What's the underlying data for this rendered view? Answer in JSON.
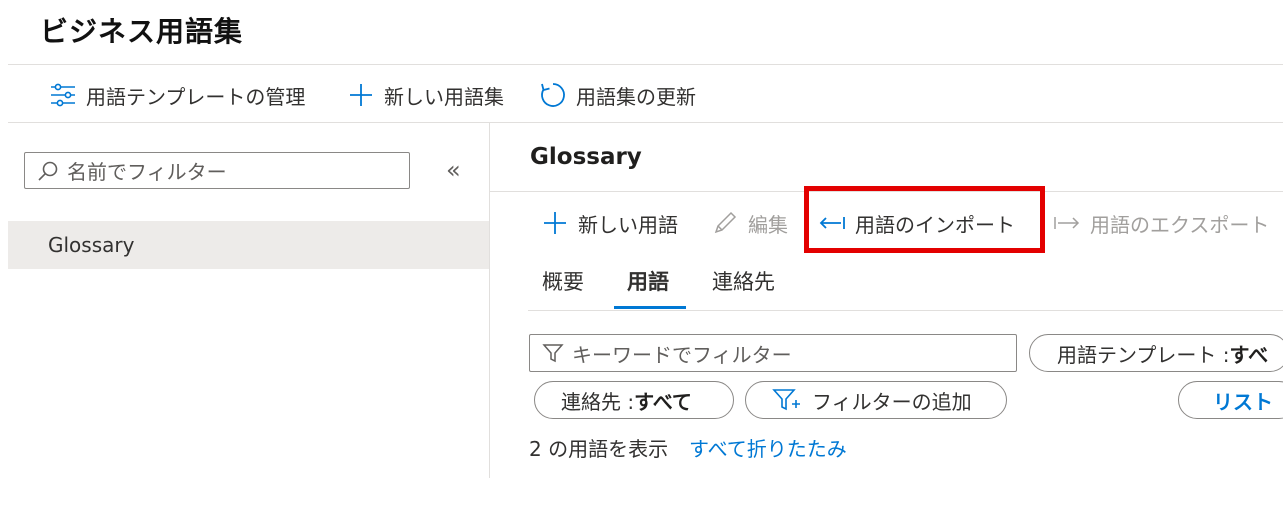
{
  "page": {
    "title": "ビジネス用語集"
  },
  "toolbar": {
    "manage_templates": "用語テンプレートの管理",
    "new_glossary": "新しい用語集",
    "refresh_glossary": "用語集の更新"
  },
  "sidebar": {
    "search_placeholder": "名前でフィルター",
    "collapse_glyph": "«",
    "items": [
      {
        "label": "Glossary",
        "selected": true
      }
    ]
  },
  "main": {
    "heading": "Glossary",
    "commands": {
      "new_term": "新しい用語",
      "edit": "編集",
      "import_terms": "用語のインポート",
      "export_terms": "用語のエクスポート"
    },
    "tabs": [
      {
        "label": "概要",
        "active": false
      },
      {
        "label": "用語",
        "active": true
      },
      {
        "label": "連絡先",
        "active": false
      }
    ],
    "filters": {
      "keyword_placeholder": "キーワードでフィルター",
      "template_label": "用語テンプレート : ",
      "template_value": "すべ",
      "contact_label": "連絡先 : ",
      "contact_value": "すべて",
      "add_filter": "フィルターの追加",
      "list_view": "リスト"
    },
    "status": {
      "count_text": "2 の用語を表示",
      "collapse_all": "すべて折りたたみ"
    }
  },
  "colors": {
    "accent": "#0078d4",
    "highlight": "#e30000",
    "selected_bg": "#edebe9"
  }
}
